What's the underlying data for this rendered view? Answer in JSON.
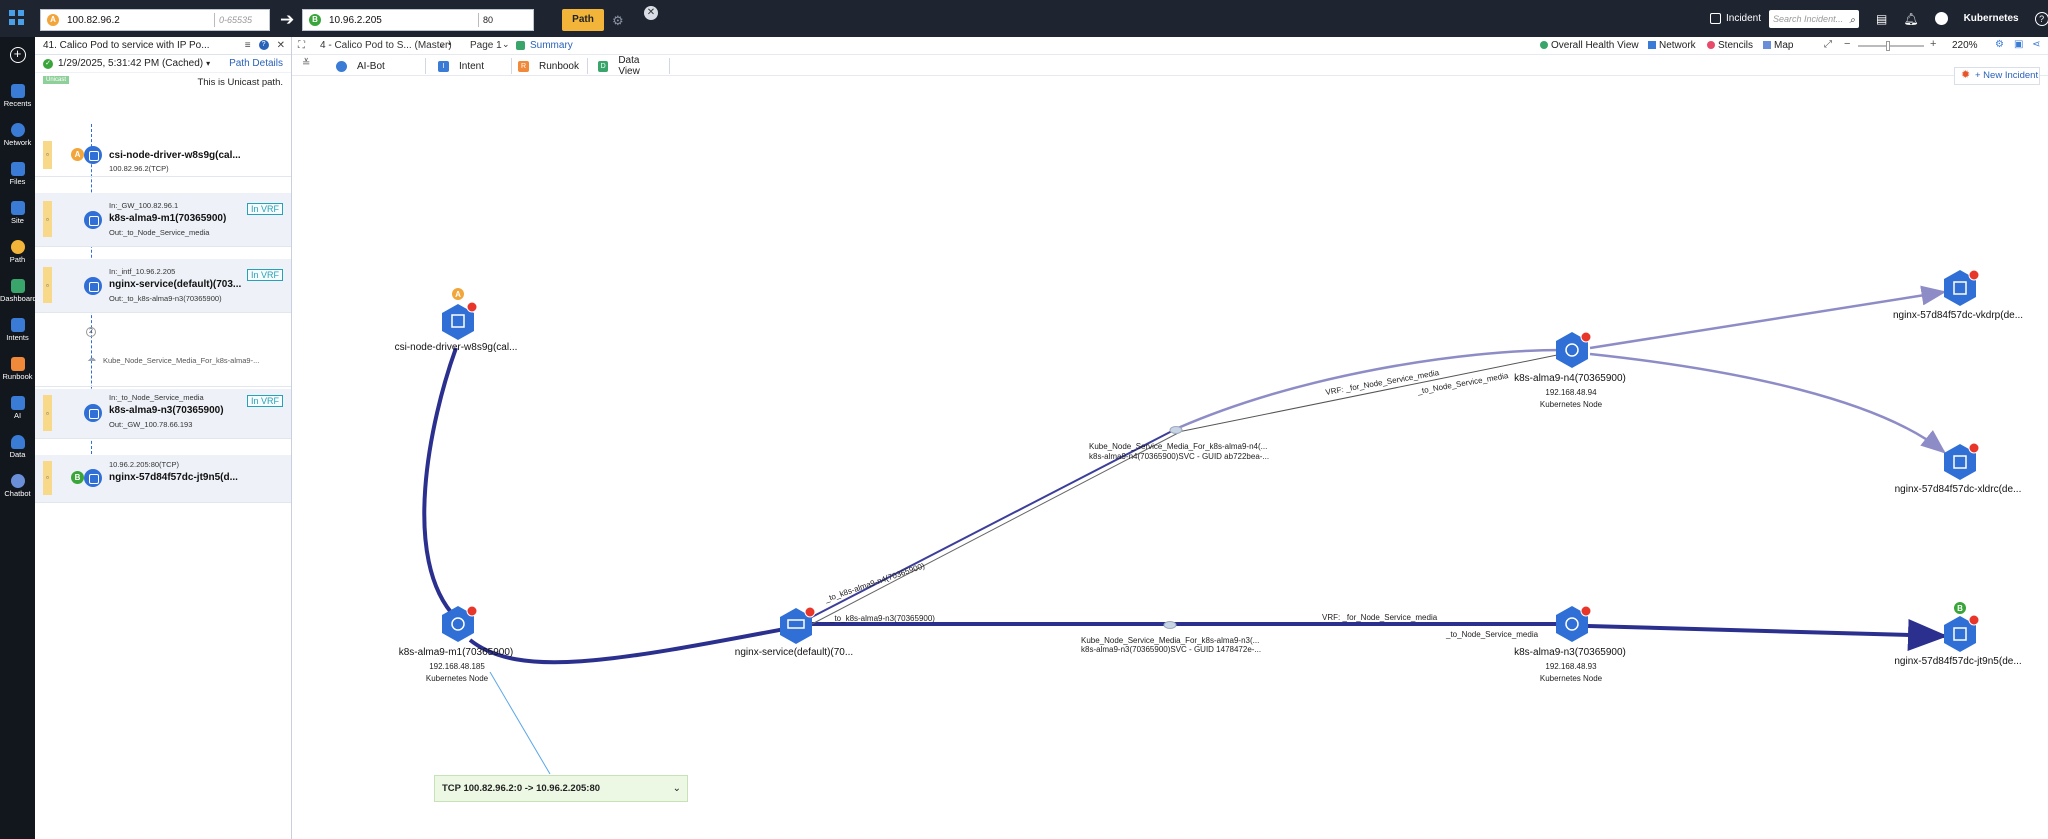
{
  "topbar": {
    "source_ip": "100.82.96.2",
    "source_port_placeholder": "0-65535",
    "dest_ip": "10.96.2.205",
    "dest_port": "80",
    "path_button": "Path",
    "source_badge": "A",
    "dest_badge": "B",
    "incident_label": "Incident",
    "incident_search_placeholder": "Search Incident...",
    "user_label": "Kubernetes"
  },
  "leftnav": {
    "items": [
      {
        "label": "Recents",
        "icon": "recents-icon",
        "color": "#3a7bd5"
      },
      {
        "label": "Network",
        "icon": "network-icon",
        "color": "#3a7bd5"
      },
      {
        "label": "Files",
        "icon": "files-icon",
        "color": "#3a7bd5"
      },
      {
        "label": "Site",
        "icon": "site-icon",
        "color": "#3a7bd5"
      },
      {
        "label": "Path",
        "icon": "path-icon",
        "color": "#f2b53a"
      },
      {
        "label": "Dashboard",
        "icon": "dashboard-icon",
        "color": "#3aa56a"
      },
      {
        "label": "Intents",
        "icon": "intents-icon",
        "color": "#3a7bd5"
      },
      {
        "label": "Runbook",
        "icon": "runbook-icon",
        "color": "#f08a3a"
      },
      {
        "label": "AI",
        "icon": "ai-icon",
        "color": "#3a7bd5"
      },
      {
        "label": "Data",
        "icon": "data-icon",
        "color": "#3a7bd5"
      },
      {
        "label": "Chatbot",
        "icon": "chatbot-icon",
        "color": "#6a8fd8"
      }
    ]
  },
  "sidepanel": {
    "title": "41. Calico Pod to service with IP Po...",
    "timestamp": "1/29/2025, 5:31:42 PM (Cached)",
    "path_details": "Path Details",
    "unicast_tag": "Unicast",
    "unicast_text": "This is Unicast path.",
    "hops": [
      {
        "top_text": "",
        "name": "csi-node-driver-w8s9g(cal...",
        "bottom_text": "100.82.96.2(TCP)",
        "vrf": "",
        "badge": "A"
      },
      {
        "top_text": "In:_GW_100.82.96.1",
        "name": "k8s-alma9-m1(70365900)",
        "bottom_text": "Out:_to_Node_Service_media",
        "vrf": "In VRF",
        "badge": ""
      },
      {
        "top_text": "In:_intf_10.96.2.205",
        "name": "nginx-service(default)(703...",
        "bottom_text": "Out:_to_k8s-alma9-n3(70365900)",
        "vrf": "In VRF",
        "badge": ""
      },
      {
        "top_text": "Kube_Node_Service_Media_For_k8s-alma9-...",
        "name": "",
        "bottom_text": "",
        "vrf": "",
        "badge": ""
      },
      {
        "top_text": "In:_to_Node_Service_media",
        "name": "k8s-alma9-n3(70365900)",
        "bottom_text": "Out:_GW_100.78.66.193",
        "vrf": "In VRF",
        "badge": ""
      },
      {
        "top_text": "10.96.2.205:80(TCP)",
        "name": "nginx-57d84f57dc-jt9n5(d...",
        "bottom_text": "",
        "vrf": "",
        "badge": "B"
      }
    ]
  },
  "mainhead": {
    "map_title": "4 - Calico Pod to S... (Master)",
    "page": "Page 1",
    "summary": "Summary",
    "overall_health": "Overall Health View",
    "network": "Network",
    "stencils": "Stencils",
    "map": "Map",
    "zoom": "220%"
  },
  "tabs": [
    {
      "label": "AI-Bot",
      "color": "#3a7bd5",
      "letter": ""
    },
    {
      "label": "Intent",
      "color": "#3a7bd5",
      "letter": "I"
    },
    {
      "label": "Runbook",
      "color": "#f08a3a",
      "letter": "R"
    },
    {
      "label": "Data View",
      "color": "#3aa56a",
      "letter": "D"
    }
  ],
  "canvas": {
    "new_incident": "+ New Incident",
    "tcp_flow": "TCP 100.82.96.2:0 -> 10.96.2.205:80",
    "nodes": [
      {
        "id": "csi",
        "name": "csi-node-driver-w8s9g(cal...",
        "line2": "",
        "line3": "",
        "badge": "A"
      },
      {
        "id": "m1",
        "name": "k8s-alma9-m1(70365900)",
        "line2": "192.168.48.185",
        "line3": "Kubernetes Node",
        "badge": ""
      },
      {
        "id": "svc",
        "name": "nginx-service(default)(70...",
        "line2": "",
        "line3": "",
        "badge": ""
      },
      {
        "id": "n4",
        "name": "k8s-alma9-n4(70365900)",
        "line2": "192.168.48.94",
        "line3": "Kubernetes Node",
        "badge": ""
      },
      {
        "id": "n3",
        "name": "k8s-alma9-n3(70365900)",
        "line2": "192.168.48.93",
        "line3": "Kubernetes Node",
        "badge": ""
      },
      {
        "id": "vkdrp",
        "name": "nginx-57d84f57dc-vkdrp(de...",
        "line2": "",
        "line3": "",
        "badge": ""
      },
      {
        "id": "xldrc",
        "name": "nginx-57d84f57dc-xldrc(de...",
        "line2": "",
        "line3": "",
        "badge": ""
      },
      {
        "id": "jt9n5",
        "name": "nginx-57d84f57dc-jt9n5(de...",
        "line2": "",
        "line3": "",
        "badge": "B"
      }
    ],
    "link_labels": {
      "to_n4": "_to_k8s-alma9-n4(70365900)",
      "to_n3": "_to_k8s-alma9-n3(70365900)",
      "vrf_upper": "VRF: _for_Node_Service_media",
      "to_node_upper": "_to_Node_Service_media",
      "vrf_lower": "VRF: _for_Node_Service_media",
      "to_node_lower": "_to_Node_Service_media",
      "svc_upper_1": "Kube_Node_Service_Media_For_k8s-alma9-n4(...",
      "svc_upper_2": "k8s-alma9-n4(70365900)SVC - GUID ab722bea-...",
      "svc_lower_1": "Kube_Node_Service_Media_For_k8s-alma9-n3(...",
      "svc_lower_2": "k8s-alma9-n3(70365900)SVC - GUID 1478472e-..."
    }
  }
}
